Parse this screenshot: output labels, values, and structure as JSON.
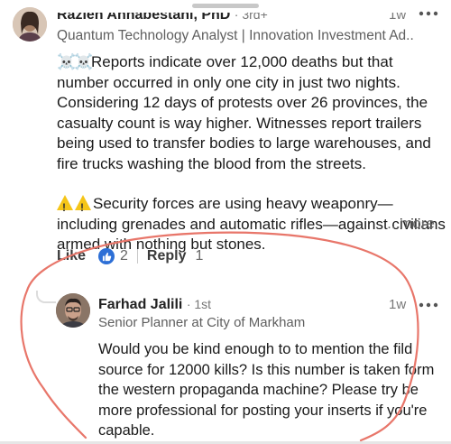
{
  "comment1": {
    "author": "Razieh Annabestani, PhD",
    "degree": "· 3rd+",
    "time": "1w",
    "headline": "Quantum Technology Analyst | Innovation Investment Ad...",
    "para1": "Reports indicate over 12,000 deaths but that number occurred in only one city in just two nights. Considering 12 days of protests over 26 provinces, the casualty count is way higher. Witnesses report trailers being used to transfer bodies to large warehouses, and fire trucks washing the blood from the streets.",
    "para2": "Security forces are using heavy weaponry—including grenades and automatic rifles—against civilians armed with nothing but stones.",
    "more_label": "...more",
    "emoji_skull": "☠️",
    "emoji_warning": "warning-icon",
    "like_label": "Like",
    "like_count": "2",
    "reply_label": "Reply",
    "reply_count": "1"
  },
  "reply": {
    "author": "Farhad Jalili",
    "degree": "· 1st",
    "time": "1w",
    "headline": "Senior Planner at City of Markham",
    "text": "Would you be kind enough to to mention the fild source for 12000 kills?  Is this number is taken form the western propaganda machine? Please try be more professional for posting your inserts if you're capable."
  },
  "colors": {
    "like_blue": "#2d6fd6",
    "annotation_red": "#e8766a",
    "warning_yellow": "#f5c518"
  }
}
